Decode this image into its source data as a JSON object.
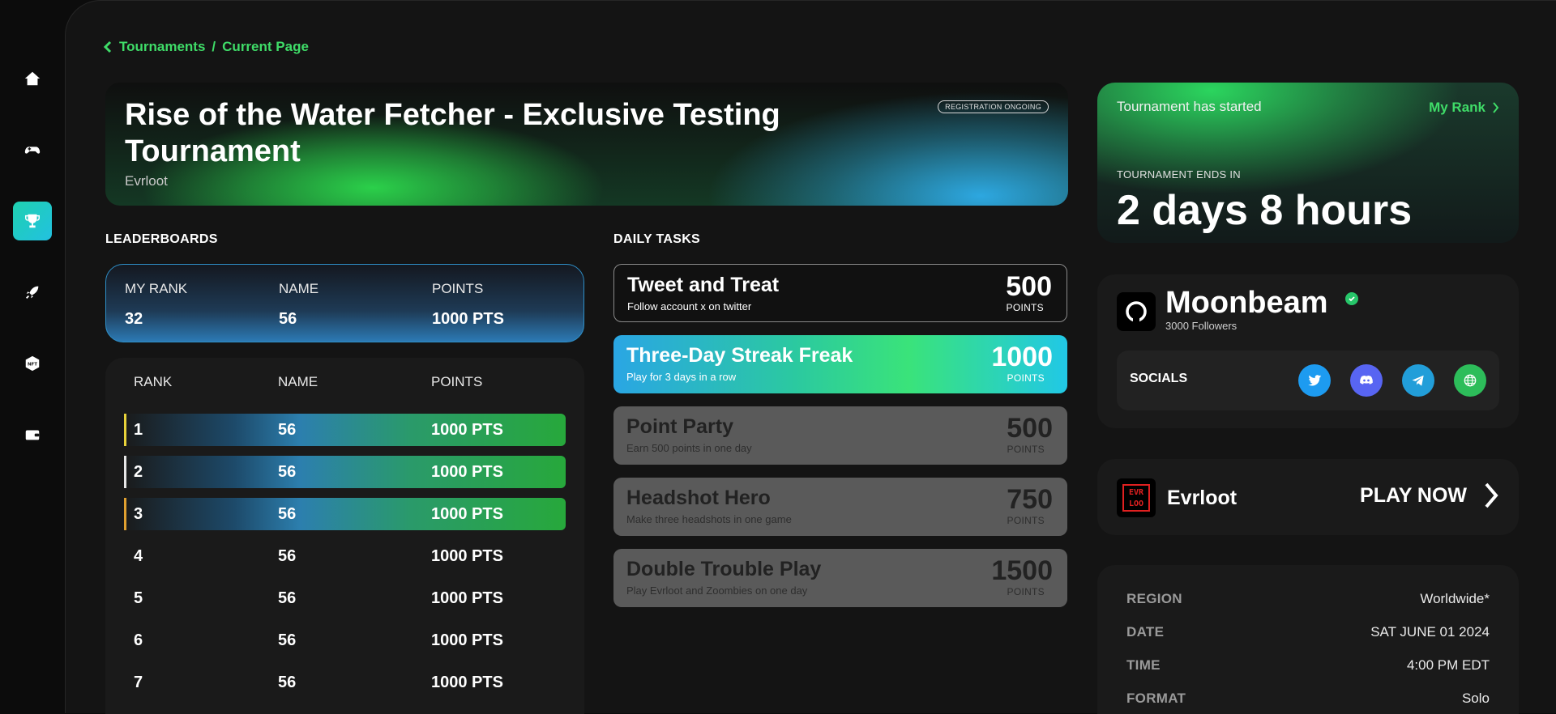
{
  "breadcrumb": {
    "parent": "Tournaments",
    "separator": "/",
    "current": "Current Page"
  },
  "sidebar": {
    "items": [
      "home",
      "games",
      "tournaments",
      "launch",
      "nft",
      "wallet"
    ],
    "active": "tournaments",
    "nft_label": "NFT"
  },
  "hero": {
    "title": "Rise of the Water Fetcher - Exclusive Testing Tournament",
    "organizer": "Evrloot",
    "badge": "REGISTRATION ONGOING"
  },
  "leaderboards": {
    "title": "LEADERBOARDS",
    "my_rank": {
      "headers": [
        "MY RANK",
        "NAME",
        "POINTS"
      ],
      "values": [
        "32",
        "56",
        "1000 PTS"
      ]
    },
    "headers": [
      "RANK",
      "NAME",
      "POINTS"
    ],
    "rows": [
      {
        "rank": "1",
        "name": "56",
        "points": "1000 PTS"
      },
      {
        "rank": "2",
        "name": "56",
        "points": "1000 PTS"
      },
      {
        "rank": "3",
        "name": "56",
        "points": "1000 PTS"
      },
      {
        "rank": "4",
        "name": "56",
        "points": "1000 PTS"
      },
      {
        "rank": "5",
        "name": "56",
        "points": "1000 PTS"
      },
      {
        "rank": "6",
        "name": "56",
        "points": "1000 PTS"
      },
      {
        "rank": "7",
        "name": "56",
        "points": "1000 PTS"
      }
    ],
    "podium_colors": [
      "#e8d23a",
      "#e6e6e6",
      "#e0a030"
    ]
  },
  "daily_tasks": {
    "title": "DAILY TASKS",
    "items": [
      {
        "title": "Tweet and Treat",
        "subtitle": "Follow account x on twitter",
        "points": "500",
        "unit": "POINTS",
        "state": "dark"
      },
      {
        "title": "Three-Day Streak Freak",
        "subtitle": "Play for 3 days in a row",
        "points": "1000",
        "unit": "POINTS",
        "state": "active"
      },
      {
        "title": "Point Party",
        "subtitle": "Earn 500 points in one day",
        "points": "500",
        "unit": "POINTS",
        "state": "locked"
      },
      {
        "title": "Headshot Hero",
        "subtitle": "Make three headshots in one game",
        "points": "750",
        "unit": "POINTS",
        "state": "locked"
      },
      {
        "title": "Double Trouble Play",
        "subtitle": "Play Evrloot and Zoombies on one day",
        "points": "1500",
        "unit": "POINTS",
        "state": "locked"
      }
    ]
  },
  "status": {
    "started": "Tournament has started",
    "my_rank_link": "My Rank",
    "ends_label": "TOURNAMENT ENDS IN",
    "ends_value": "2 days 8 hours"
  },
  "organizer_card": {
    "name": "Moonbeam",
    "followers": "3000 Followers",
    "verified": true,
    "socials_label": "SOCIALS",
    "socials": [
      {
        "name": "twitter",
        "color": "#1d9bf0"
      },
      {
        "name": "discord",
        "color": "#5865f2"
      },
      {
        "name": "telegram",
        "color": "#229ed9"
      },
      {
        "name": "website",
        "color": "#2dbd5a"
      }
    ]
  },
  "game_card": {
    "name": "Evrloot",
    "logo_text": "EVR LOO",
    "cta": "PLAY NOW"
  },
  "details": [
    {
      "label": "REGION",
      "value": "Worldwide*"
    },
    {
      "label": "DATE",
      "value": "SAT JUNE 01 2024"
    },
    {
      "label": "TIME",
      "value": "4:00 PM EDT"
    },
    {
      "label": "FORMAT",
      "value": "Solo"
    }
  ],
  "colors": {
    "accent_green": "#3fdc68",
    "accent_blue": "#2da7e0"
  }
}
